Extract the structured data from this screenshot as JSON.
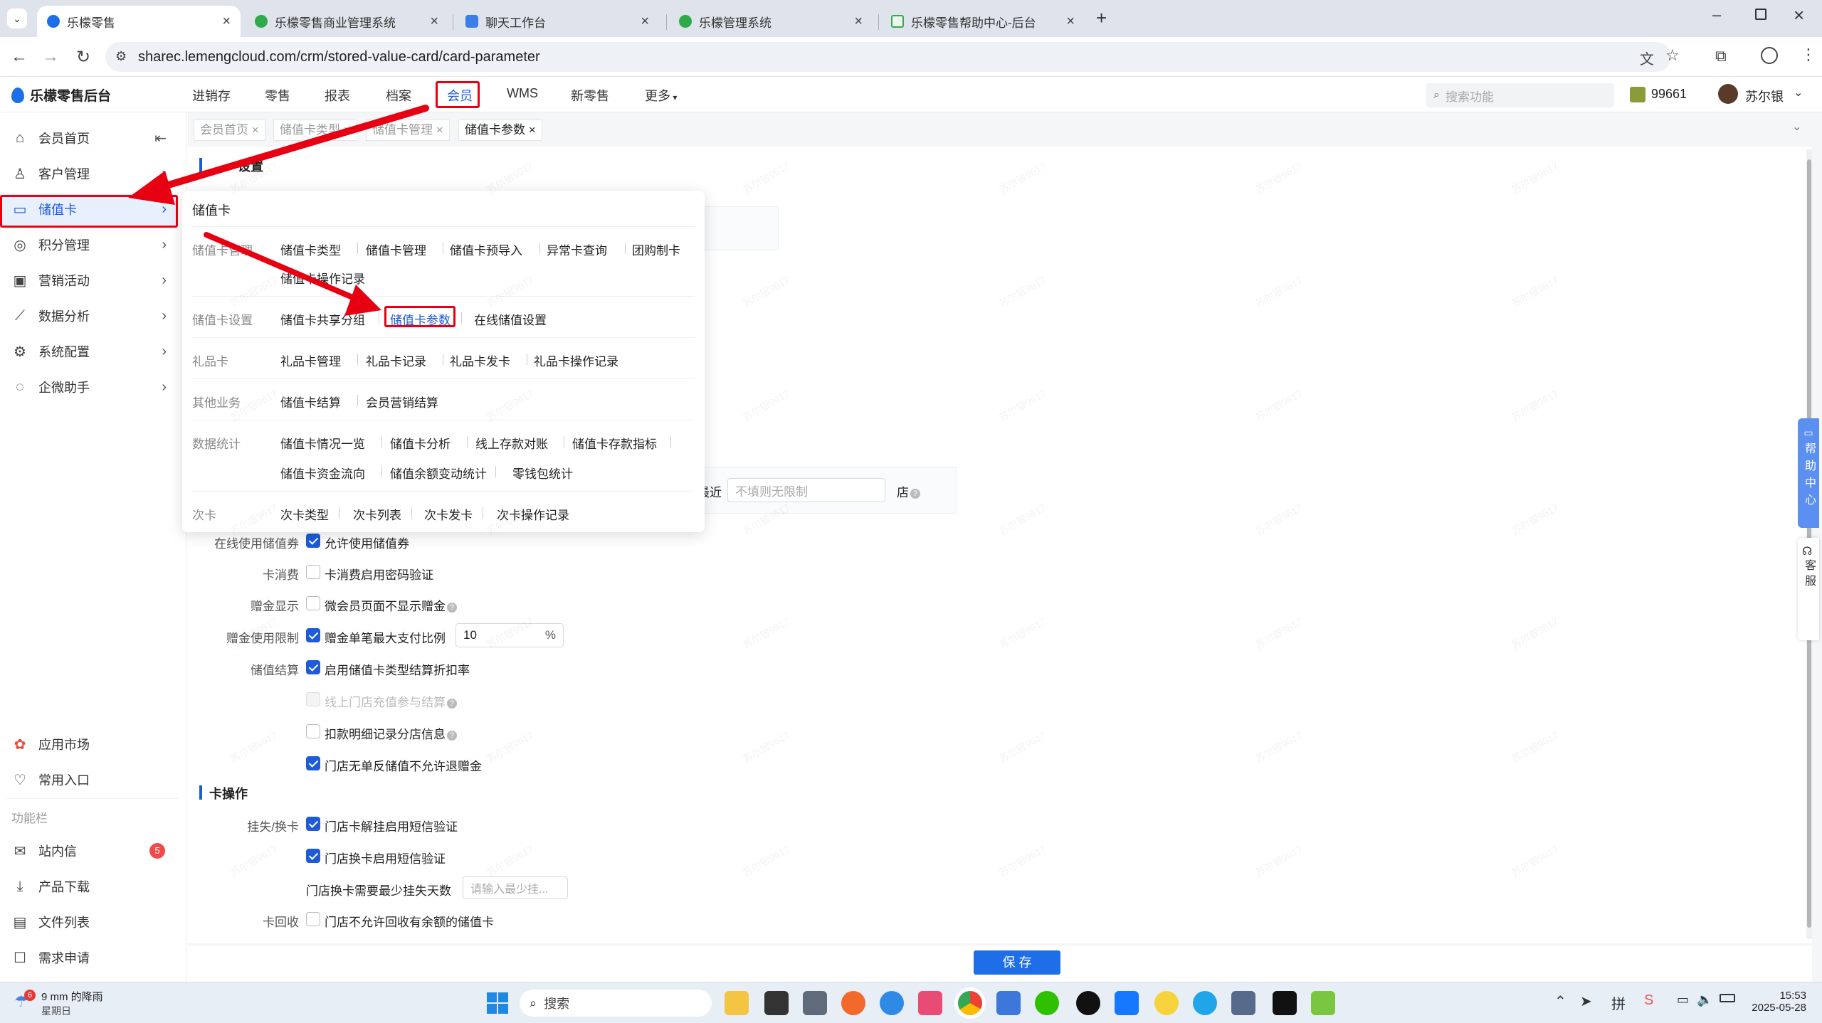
{
  "browser": {
    "tabs": [
      {
        "label": "乐檬零售",
        "active": true
      },
      {
        "label": "乐檬零售商业管理系统",
        "active": false
      },
      {
        "label": "聊天工作台",
        "active": false
      },
      {
        "label": "乐檬管理系统",
        "active": false
      },
      {
        "label": "乐檬零售帮助中心-后台",
        "active": false
      }
    ],
    "url": "sharec.lemengcloud.com/crm/stored-value-card/card-parameter"
  },
  "app": {
    "logo": "乐檬零售后台",
    "nav": [
      "进销存",
      "零售",
      "报表",
      "档案",
      "会员",
      "WMS",
      "新零售",
      "更多"
    ],
    "active_nav": "会员",
    "search_placeholder": "搜索功能",
    "points": "99661",
    "user": "苏尔银"
  },
  "sidebar": {
    "items": [
      {
        "label": "会员首页",
        "icon": "home-icon"
      },
      {
        "label": "客户管理",
        "icon": "user-icon"
      },
      {
        "label": "储值卡",
        "icon": "card-icon",
        "active": true
      },
      {
        "label": "积分管理",
        "icon": "coins-icon"
      },
      {
        "label": "营销活动",
        "icon": "chart-icon"
      },
      {
        "label": "数据分析",
        "icon": "analytics-icon"
      },
      {
        "label": "系统配置",
        "icon": "settings-icon"
      },
      {
        "label": "企微助手",
        "icon": "chat-icon"
      }
    ],
    "bottom": [
      {
        "label": "应用市场",
        "icon": "apps-icon"
      },
      {
        "label": "常用入口",
        "icon": "heart-icon"
      }
    ],
    "toolbar_title": "功能栏",
    "tools": [
      {
        "label": "站内信",
        "icon": "mail-icon",
        "badge": "5"
      },
      {
        "label": "产品下载",
        "icon": "download-icon"
      },
      {
        "label": "文件列表",
        "icon": "file-icon"
      },
      {
        "label": "需求申请",
        "icon": "request-icon"
      }
    ]
  },
  "pagetabs": [
    "会员首页",
    "储值卡类型",
    "储值卡管理",
    "储值卡参数"
  ],
  "section_top_partial": "设置",
  "menu": {
    "title": "储值卡",
    "groups": [
      {
        "cat": "储值卡管理",
        "links": [
          "储值卡类型",
          "储值卡管理",
          "储值卡预导入",
          "异常卡查询",
          "团购制卡",
          "储值卡操作记录"
        ]
      },
      {
        "cat": "储值卡设置",
        "links": [
          "储值卡共享分组",
          "储值卡参数",
          "在线储值设置"
        ]
      },
      {
        "cat": "礼品卡",
        "links": [
          "礼品卡管理",
          "礼品卡记录",
          "礼品卡发卡",
          "礼品卡操作记录"
        ]
      },
      {
        "cat": "其他业务",
        "links": [
          "储值卡结算",
          "会员营销结算"
        ]
      },
      {
        "cat": "数据统计",
        "links": [
          "储值卡情况一览",
          "储值卡分析",
          "线上存款对账",
          "储值卡存款指标",
          "储值卡资金流向",
          "储值余额变动统计",
          "零钱包统计"
        ]
      },
      {
        "cat": "次卡",
        "links": [
          "次卡类型",
          "次卡列表",
          "次卡发卡",
          "次卡操作记录"
        ]
      }
    ]
  },
  "form": {
    "recent_prefix": "最近",
    "recent_placeholder": "不填则无限制",
    "recent_suffix": "店",
    "rows": [
      {
        "label": "在线使用储值券",
        "option": "允许使用储值券",
        "checked": true
      },
      {
        "label": "卡消费",
        "option": "卡消费启用密码验证",
        "checked": false
      },
      {
        "label": "赠金显示",
        "option": "微会员页面不显示赠金",
        "checked": false
      },
      {
        "label": "赠金使用限制",
        "option": "赠金单笔最大支付比例",
        "checked": true,
        "value": "10",
        "unit": "%"
      },
      {
        "label": "储值结算",
        "option": "启用储值卡类型结算折扣率",
        "checked": true
      },
      {
        "label": "",
        "option": "线上门店充值参与结算",
        "checked": false,
        "disabled": true
      },
      {
        "label": "",
        "option": "扣款明细记录分店信息",
        "checked": false
      },
      {
        "label": "",
        "option": "门店无单反储值不允许退赠金",
        "checked": true
      }
    ],
    "section2": "卡操作",
    "rows2": [
      {
        "label": "挂失/换卡",
        "option": "门店卡解挂启用短信验证",
        "checked": true
      },
      {
        "label": "",
        "option": "门店换卡启用短信验证",
        "checked": true
      },
      {
        "label": "",
        "option": "门店换卡需要最少挂失天数",
        "placeholder": "请输入最少挂..."
      },
      {
        "label": "卡回收",
        "option": "门店不允许回收有余额的储值卡",
        "checked": false
      }
    ],
    "save": "保 存"
  },
  "help": {
    "help_center": "帮助中心",
    "service": "客服"
  },
  "watermark": "苏尔银9617",
  "taskbar": {
    "weather_temp": "9 mm 的降雨",
    "weather_day": "星期日",
    "weather_badge": "6",
    "search": "搜索",
    "time": "15:53",
    "date": "2025-05-28"
  },
  "colors": {
    "accent": "#1e5bd8",
    "annotation": "#e60012"
  }
}
